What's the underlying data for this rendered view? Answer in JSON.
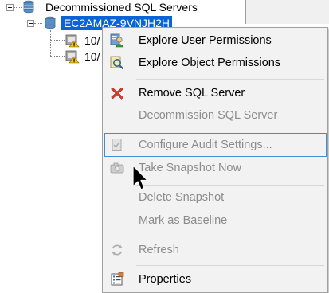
{
  "tree": {
    "root_label": "Decommissioned SQL Servers",
    "selected_label": "EC2AMAZ-9VNJH2H",
    "child_1_label": "10/",
    "child_2_label": "10/"
  },
  "menu": {
    "items": [
      {
        "label": "Explore User Permissions",
        "icon": "user-permissions-icon",
        "enabled": true
      },
      {
        "label": "Explore Object Permissions",
        "icon": "object-permissions-icon",
        "enabled": true
      },
      {
        "label": "Remove SQL Server",
        "icon": "red-x-icon",
        "enabled": true
      },
      {
        "label": "Decommission SQL Server",
        "icon": "",
        "enabled": false
      },
      {
        "label": "Configure Audit Settings...",
        "icon": "audit-settings-icon",
        "enabled": false
      },
      {
        "label": "Take Snapshot Now",
        "icon": "camera-icon",
        "enabled": false
      },
      {
        "label": "Delete Snapshot",
        "icon": "",
        "enabled": false
      },
      {
        "label": "Mark as Baseline",
        "icon": "",
        "enabled": false
      },
      {
        "label": "Refresh",
        "icon": "refresh-icon",
        "enabled": false
      },
      {
        "label": "Properties",
        "icon": "properties-icon",
        "enabled": true
      }
    ]
  },
  "colors": {
    "selection": "#0a64d6",
    "menu_background": "#f2f2f2",
    "disabled_text": "#8c8c8c",
    "hover_border": "#3c8fd6",
    "remove_icon": "#d83b2a"
  }
}
